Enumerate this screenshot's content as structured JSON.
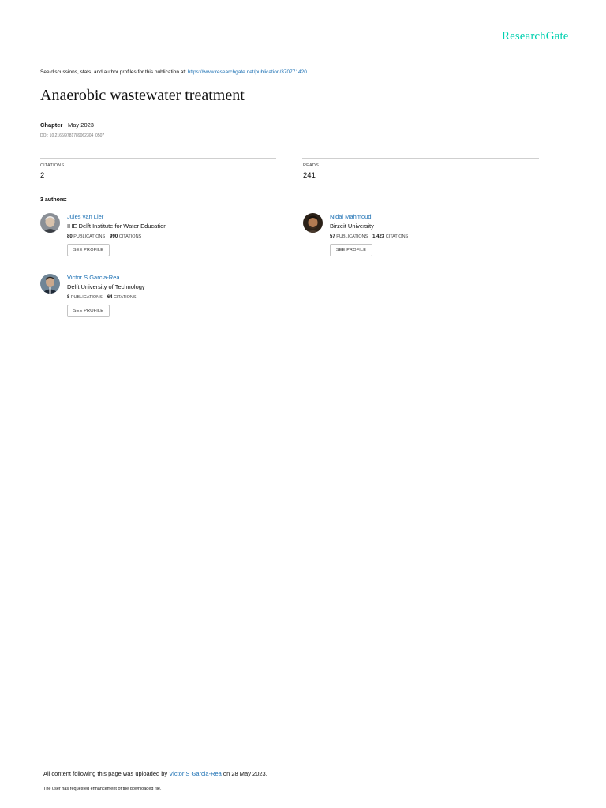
{
  "brand": {
    "logo_text": "ResearchGate",
    "accent_color": "#00d0af",
    "link_color": "#1a6fb3"
  },
  "intro": {
    "prefix": "See discussions, stats, and author profiles for this publication at: ",
    "url": "https://www.researchgate.net/publication/370771420"
  },
  "publication": {
    "title": "Anaerobic wastewater treatment",
    "type": "Chapter",
    "separator": " · ",
    "date": "May 2023",
    "doi": "DOI: 10.2166/9781789062304_0507"
  },
  "stats": {
    "citations": {
      "label": "CITATIONS",
      "value": "2"
    },
    "reads": {
      "label": "READS",
      "value": "241"
    }
  },
  "authors_heading": "3 authors:",
  "authors": [
    {
      "name": "Jules van Lier",
      "institution": "IHE Delft Institute for Water Education",
      "publications": "80",
      "publications_label": "PUBLICATIONS",
      "citations": "990",
      "citations_label": "CITATIONS",
      "button": "SEE PROFILE"
    },
    {
      "name": "Nidal Mahmoud",
      "institution": "Birzeit University",
      "publications": "57",
      "publications_label": "PUBLICATIONS",
      "citations": "1,423",
      "citations_label": "CITATIONS",
      "button": "SEE PROFILE"
    },
    {
      "name": "Victor S Garcia-Rea",
      "institution": "Delft University of Technology",
      "publications": "8",
      "publications_label": "PUBLICATIONS",
      "citations": "64",
      "citations_label": "CITATIONS",
      "button": "SEE PROFILE"
    }
  ],
  "footer": {
    "upload_prefix": "All content following this page was uploaded by ",
    "uploader": "Victor S Garcia-Rea",
    "upload_suffix": " on 28 May 2023.",
    "note": "The user has requested enhancement of the downloaded file."
  }
}
